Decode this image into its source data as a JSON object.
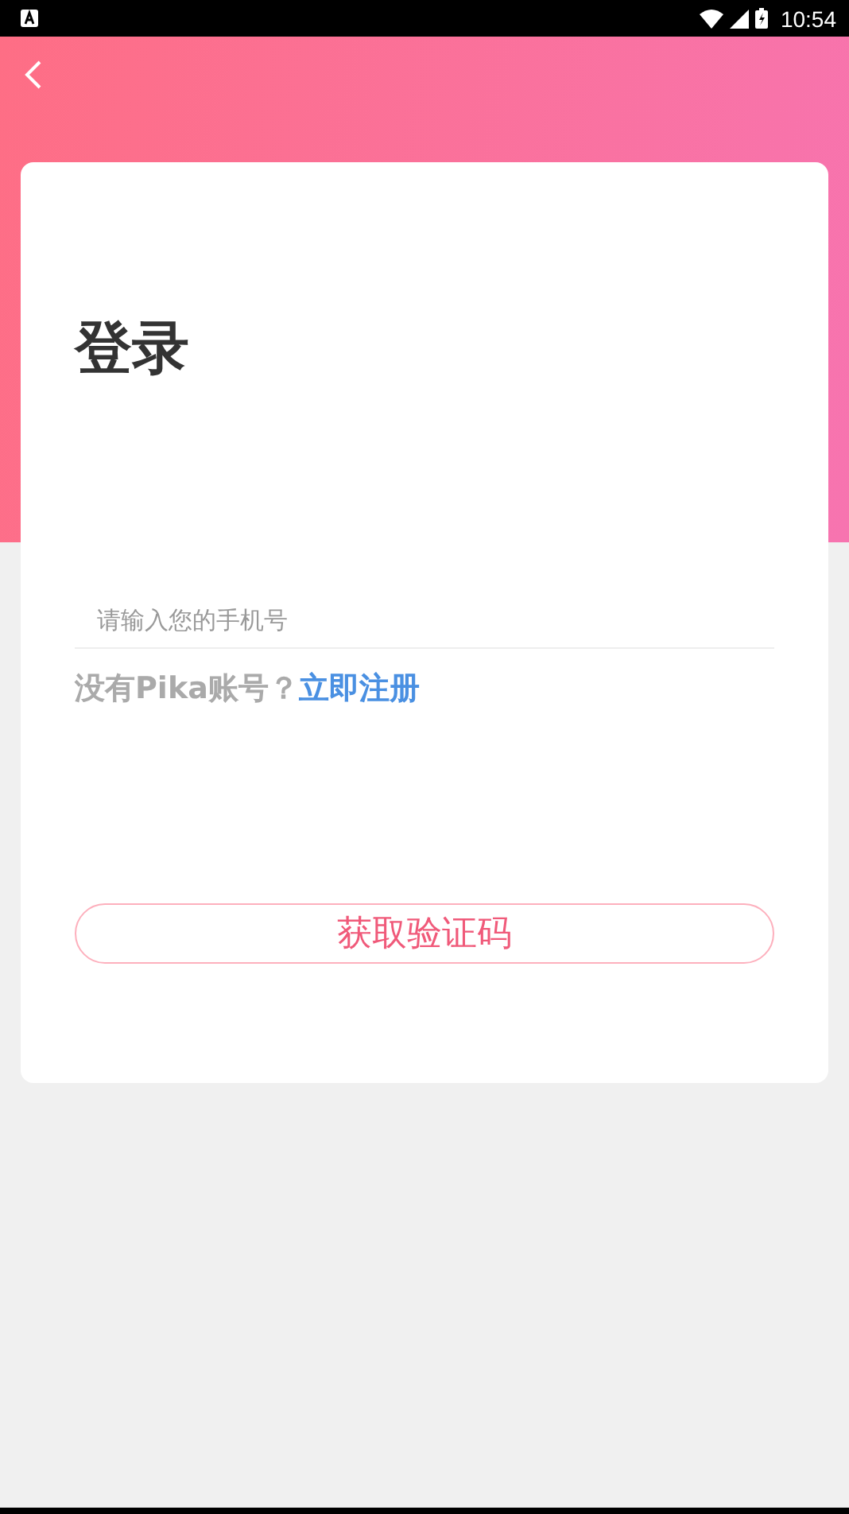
{
  "status_bar": {
    "time": "10:54"
  },
  "title": "登录",
  "phone_field": {
    "placeholder": "请输入您的手机号"
  },
  "register_prompt": {
    "text": "没有Pika账号？",
    "link": "立即注册"
  },
  "submit_button": {
    "label": "获取验证码"
  }
}
